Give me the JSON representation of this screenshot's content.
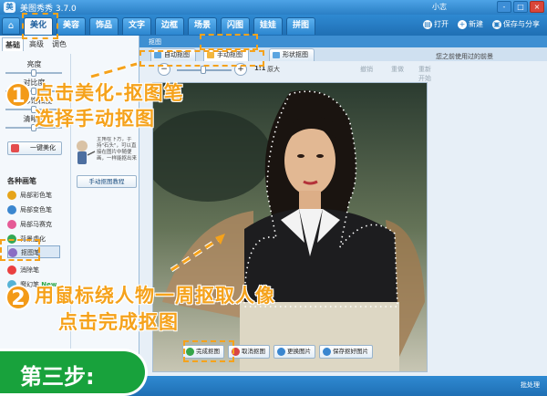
{
  "app": {
    "title": "美图秀秀 3.7.0",
    "user": "小志"
  },
  "window_controls": [
    "-",
    "□",
    "×"
  ],
  "main_tabs": [
    {
      "label": "美化",
      "active": true
    },
    {
      "label": "美容"
    },
    {
      "label": "饰品"
    },
    {
      "label": "文字"
    },
    {
      "label": "边框"
    },
    {
      "label": "场景"
    },
    {
      "label": "闪图"
    },
    {
      "label": "娃娃"
    },
    {
      "label": "拼图"
    }
  ],
  "header_actions": {
    "open": "打开",
    "new": "新建",
    "save_share": "保存与分享"
  },
  "left_panel": {
    "subtabs": [
      "基础",
      "高级",
      "调色"
    ],
    "sliders": [
      {
        "label": "亮度",
        "value": 0.5
      },
      {
        "label": "对比度",
        "value": 0.5
      },
      {
        "label": "色彩饱和度",
        "value": 0.5
      },
      {
        "label": "清晰度",
        "value": 0.5
      }
    ],
    "onekey_button": "一键美化",
    "tools_title": "各种画笔",
    "tools": [
      {
        "label": "局部彩色笔",
        "color": "#e6a41a"
      },
      {
        "label": "局部变色笔",
        "color": "#3a86cf"
      },
      {
        "label": "局部马赛克",
        "color": "#e55a96"
      },
      {
        "label": "背景虚化",
        "color": "#33a855"
      },
      {
        "label": "抠图笔",
        "color": "#8a6ec4",
        "active": true
      },
      {
        "label": "消除笔",
        "color": "#ea4040"
      },
      {
        "label": "魔幻笔",
        "color": "#56b3d6",
        "badge": "New"
      }
    ]
  },
  "help": {
    "note": "主角在下方，手持\"石头\"，可以直接在图片中随便画，一样能抠出来",
    "tutorial_button": "手动抠图教程"
  },
  "main_window": {
    "header": "抠图",
    "subtabs": [
      {
        "label": "自动抠图",
        "color": "#5aa4e0"
      },
      {
        "label": "手动抠图",
        "color": "#f3b63d",
        "active": true
      },
      {
        "label": "形状抠图",
        "color": "#5aa4e0"
      }
    ],
    "zoom_label": "1:1",
    "original_label": "原大",
    "undo": "撤销",
    "redo": "重做",
    "redraw": "重新开始",
    "right_note": "您之前使用过的前景",
    "bottom_buttons": [
      {
        "label": "完成抠图",
        "color": "#35a64a"
      },
      {
        "label": "取消抠图",
        "color": "#d84545"
      },
      {
        "label": "更换图片",
        "color": "#3a86cf"
      },
      {
        "label": "保存抠好图片",
        "color": "#3a86cf"
      }
    ]
  },
  "status": {
    "right": "批处理"
  },
  "annotations": {
    "step1_number": "1",
    "step1_line1": "点击美化-抠图笔",
    "step1_line2": "选择手动抠图",
    "step2_number": "2",
    "step2_line1": "用鼠标绕人物一周抠取人像",
    "step2_line2": "点击完成抠图",
    "step3": "第三步:"
  }
}
